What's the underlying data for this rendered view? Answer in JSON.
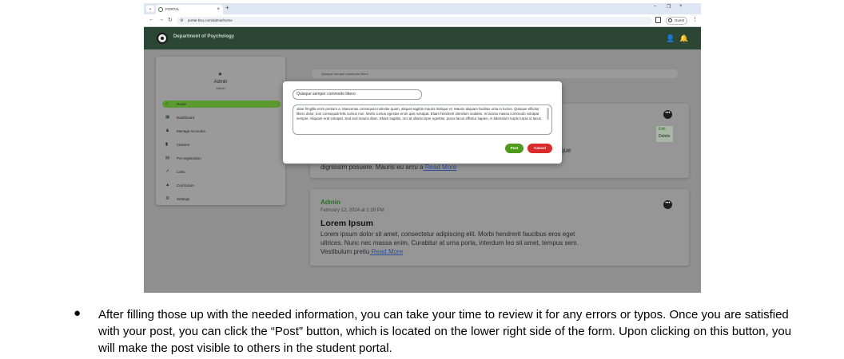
{
  "browser": {
    "tab_title": "PORTAL",
    "tab_close": "×",
    "new_tab": "+",
    "url": "portal-bsu.com/admin/home",
    "profile_label": "Guest",
    "window_controls": [
      "–",
      "❐",
      "×"
    ]
  },
  "header": {
    "department": "Department of Psychology"
  },
  "sidebar": {
    "name": "Admin",
    "role": "Admin",
    "items": [
      {
        "label": "Home",
        "icon": "home-icon"
      },
      {
        "label": "Dashboard",
        "icon": "dashboard-icon"
      },
      {
        "label": "Manage Accounts",
        "icon": "accounts-icon"
      },
      {
        "label": "Classes",
        "icon": "book-icon"
      },
      {
        "label": "Pre-registration",
        "icon": "document-icon"
      },
      {
        "label": "Links",
        "icon": "link-icon"
      },
      {
        "label": "Curriculum",
        "icon": "graduation-cap-icon"
      },
      {
        "label": "Settings",
        "icon": "gear-icon"
      }
    ]
  },
  "feed": {
    "search_placeholder": "Quisque semper commodo libero",
    "post1": {
      "tail_text": "que",
      "last_line": "dignissim posuere. Mauris eu arcu a",
      "read_more": " Read More",
      "menu_edit": "Edit",
      "menu_delete": "Delete"
    },
    "post2": {
      "author": "Admin",
      "date": "February 12, 2024 at 1:28 PM",
      "title": "Lorem Ipsum",
      "body": "Lorem ipsum dolor sit amet, consectetur adipiscing elit. Morbi hendrerit faucibus eros eget ultrices. Nunc nec massa enim. Curabitur at urna porta, interdum leo sit amet, tempus sem. Vestibulum pretiu",
      "read_more": " Read More"
    }
  },
  "modal": {
    "title_value": "Quisque semper commodo libero",
    "body_value": "vitae fringilla enim pretium a. Maecenas consequat molestie quam, aliquet sagittis mauris tristique et. Mauris aliquam facilisis urna in luctus. Quisque efficitur libero dolor, non consequat felis cursus non. Morbi cursus egestas enim quis volutpat. Etiam hendrerit interdum sodales. In lacinia massa commodo volutpat semper. Aliquam erat volutpat. Sed sed mauris diam. Etiam sagittis, orci at ullamcorper egestas, purus lacus efficitur sapien, in bibendum turpis turpis id lacus.",
    "post_label": "Post",
    "cancel_label": "Cancel"
  },
  "caption": {
    "bullet": "●",
    "text": "After filling those up with the needed information, you can take your time to review it for any errors or typos. Once you are satisfied with your post, you can click the “Post” button, which is located on the lower right side of the form. Upon clicking on this button, you will make the post visible to others in the student portal."
  }
}
